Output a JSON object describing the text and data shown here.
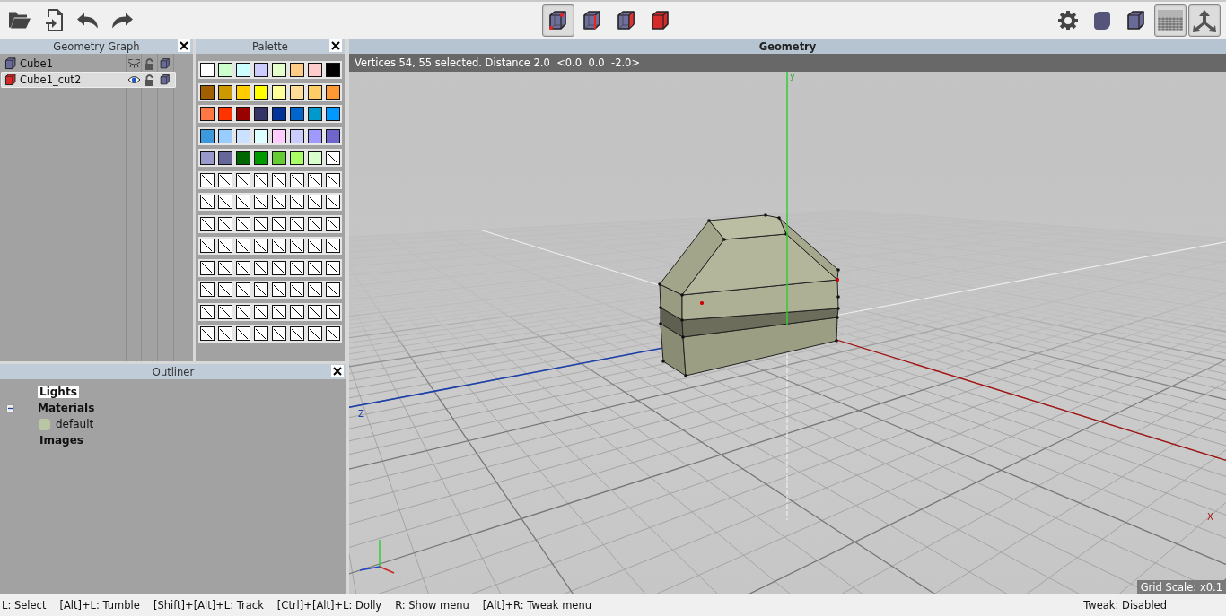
{
  "toolbar": {
    "selection_modes": [
      {
        "kind": "vertex",
        "selected": true
      },
      {
        "kind": "edge",
        "selected": false
      },
      {
        "kind": "face",
        "selected": false
      },
      {
        "kind": "body",
        "selected": false
      }
    ],
    "view_toggles": [
      {
        "kind": "settings",
        "on": false
      },
      {
        "kind": "smooth",
        "on": false
      },
      {
        "kind": "flat",
        "on": false
      },
      {
        "kind": "ground",
        "on": true
      },
      {
        "kind": "axes",
        "on": true
      }
    ]
  },
  "geometry_graph": {
    "title": "Geometry Graph",
    "objects": [
      {
        "name": "Cube1",
        "selected": false,
        "visible": false,
        "locked": false
      },
      {
        "name": "Cube1_cut2",
        "selected": true,
        "visible": true,
        "locked": false
      }
    ]
  },
  "palette": {
    "title": "Palette",
    "swatches": [
      {
        "kind": "color",
        "color": "#ffffff"
      },
      {
        "kind": "color",
        "color": "#ccffcc"
      },
      {
        "kind": "color",
        "color": "#ccffff"
      },
      {
        "kind": "color",
        "color": "#ccccff"
      },
      {
        "kind": "color",
        "color": "#e5ffcc"
      },
      {
        "kind": "color",
        "color": "#ffcc88"
      },
      {
        "kind": "color",
        "color": "#ffcccc"
      },
      {
        "kind": "color",
        "color": "#000000"
      },
      {
        "kind": "color",
        "color": "#a06000"
      },
      {
        "kind": "color",
        "color": "#cc9900"
      },
      {
        "kind": "color",
        "color": "#ffcc00"
      },
      {
        "kind": "color",
        "color": "#ffff00"
      },
      {
        "kind": "color",
        "color": "#ffff99"
      },
      {
        "kind": "color",
        "color": "#ffdd99"
      },
      {
        "kind": "color",
        "color": "#ffcc66"
      },
      {
        "kind": "color",
        "color": "#ff9933"
      },
      {
        "kind": "color",
        "color": "#ff7744"
      },
      {
        "kind": "color",
        "color": "#ff3300"
      },
      {
        "kind": "color",
        "color": "#990000"
      },
      {
        "kind": "color",
        "color": "#333366"
      },
      {
        "kind": "color",
        "color": "#003399"
      },
      {
        "kind": "color",
        "color": "#0066cc"
      },
      {
        "kind": "color",
        "color": "#0099cc"
      },
      {
        "kind": "color",
        "color": "#0099ff"
      },
      {
        "kind": "color",
        "color": "#3d99dd"
      },
      {
        "kind": "color",
        "color": "#99ccff"
      },
      {
        "kind": "color",
        "color": "#cce0ff"
      },
      {
        "kind": "color",
        "color": "#ddffff"
      },
      {
        "kind": "color",
        "color": "#ffccff"
      },
      {
        "kind": "color",
        "color": "#ccccff"
      },
      {
        "kind": "color",
        "color": "#a099ff"
      },
      {
        "kind": "color",
        "color": "#6e66cc"
      },
      {
        "kind": "color",
        "color": "#9999cc"
      },
      {
        "kind": "color",
        "color": "#666699"
      },
      {
        "kind": "color",
        "color": "#006600"
      },
      {
        "kind": "color",
        "color": "#009900"
      },
      {
        "kind": "color",
        "color": "#66cc33"
      },
      {
        "kind": "color",
        "color": "#a8ff66"
      },
      {
        "kind": "color",
        "color": "#d9ffcc"
      },
      {
        "kind": "empty"
      },
      {
        "kind": "empty"
      },
      {
        "kind": "empty"
      },
      {
        "kind": "empty"
      },
      {
        "kind": "empty"
      },
      {
        "kind": "empty"
      },
      {
        "kind": "empty"
      },
      {
        "kind": "empty"
      },
      {
        "kind": "empty"
      },
      {
        "kind": "empty"
      },
      {
        "kind": "empty"
      },
      {
        "kind": "empty"
      },
      {
        "kind": "empty"
      },
      {
        "kind": "empty"
      },
      {
        "kind": "empty"
      },
      {
        "kind": "empty"
      },
      {
        "kind": "empty"
      },
      {
        "kind": "empty"
      },
      {
        "kind": "empty"
      },
      {
        "kind": "empty"
      },
      {
        "kind": "empty"
      },
      {
        "kind": "empty"
      },
      {
        "kind": "empty"
      },
      {
        "kind": "empty"
      },
      {
        "kind": "empty"
      },
      {
        "kind": "empty"
      },
      {
        "kind": "empty"
      },
      {
        "kind": "empty"
      },
      {
        "kind": "empty"
      },
      {
        "kind": "empty"
      },
      {
        "kind": "empty"
      },
      {
        "kind": "empty"
      },
      {
        "kind": "empty"
      },
      {
        "kind": "empty"
      },
      {
        "kind": "empty"
      },
      {
        "kind": "empty"
      },
      {
        "kind": "empty"
      },
      {
        "kind": "empty"
      },
      {
        "kind": "empty"
      },
      {
        "kind": "empty"
      },
      {
        "kind": "empty"
      },
      {
        "kind": "empty"
      },
      {
        "kind": "empty"
      },
      {
        "kind": "empty"
      },
      {
        "kind": "empty"
      },
      {
        "kind": "empty"
      },
      {
        "kind": "empty"
      },
      {
        "kind": "empty"
      },
      {
        "kind": "empty"
      },
      {
        "kind": "empty"
      },
      {
        "kind": "empty"
      },
      {
        "kind": "empty"
      },
      {
        "kind": "empty"
      },
      {
        "kind": "empty"
      },
      {
        "kind": "empty"
      },
      {
        "kind": "empty"
      },
      {
        "kind": "empty"
      },
      {
        "kind": "empty"
      },
      {
        "kind": "empty"
      },
      {
        "kind": "empty"
      },
      {
        "kind": "empty"
      },
      {
        "kind": "empty"
      },
      {
        "kind": "empty"
      },
      {
        "kind": "empty"
      },
      {
        "kind": "empty"
      }
    ]
  },
  "outliner": {
    "title": "Outliner",
    "items": [
      {
        "label": "Lights",
        "selected": true
      },
      {
        "label": "Materials",
        "selected": false,
        "expanded": true,
        "children": [
          {
            "label": "default",
            "selected": false
          }
        ]
      },
      {
        "label": "Images",
        "selected": false
      }
    ]
  },
  "geometry": {
    "title": "Geometry",
    "info": "Vertices 54, 55 selected. Distance 2.0  <0.0  0.0  -2.0>",
    "axis_labels": {
      "x": "X",
      "y": "y",
      "z": "Z"
    },
    "grid_scale": "Grid Scale: x0.1"
  },
  "status_bar": {
    "hints": [
      "L: Select",
      "[Alt]+L: Tumble",
      "[Shift]+[Alt]+L: Track",
      "[Ctrl]+[Alt]+L: Dolly",
      "R: Show menu",
      "[Alt]+R: Tweak menu"
    ],
    "tweak": "Tweak: Disabled"
  }
}
